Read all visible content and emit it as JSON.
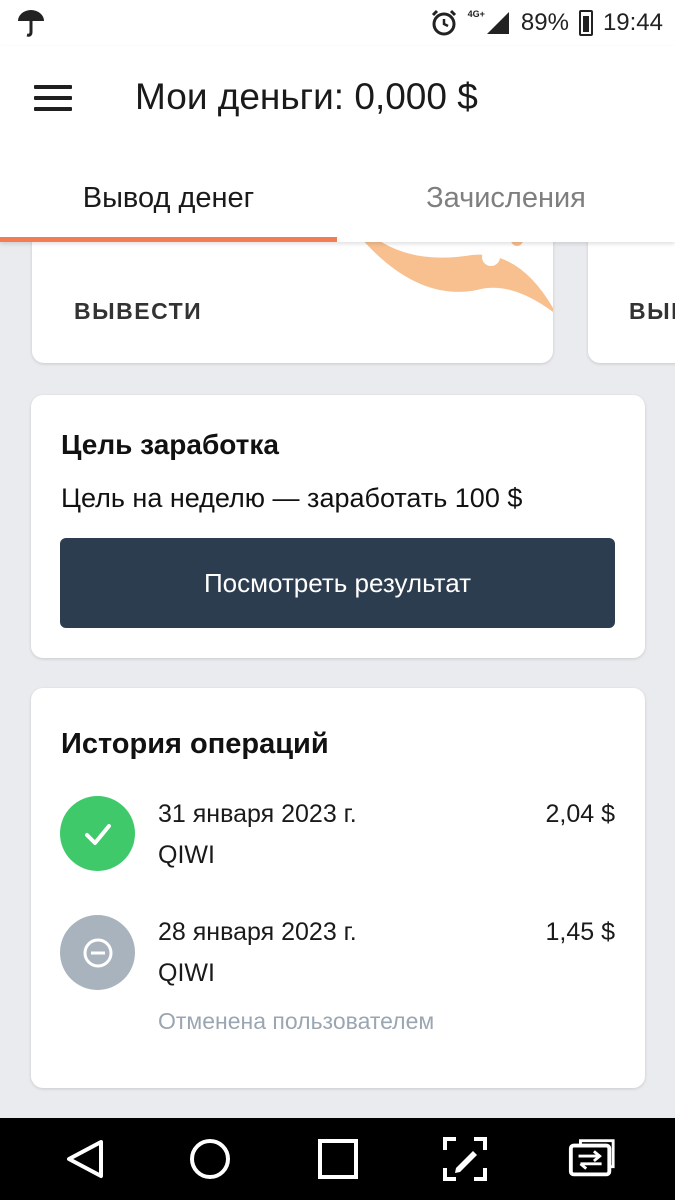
{
  "status_bar": {
    "network": "4G+",
    "battery": "89%",
    "time": "19:44",
    "icons": [
      "umbrella-icon",
      "alarm-icon",
      "signal-icon",
      "battery-icon"
    ]
  },
  "header": {
    "title": "Мои деньги: 0,000 $",
    "menu_icon": "hamburger-menu-icon"
  },
  "tabs": [
    {
      "label": "Вывод денег",
      "active": true
    },
    {
      "label": "Зачисления",
      "active": false
    }
  ],
  "promo_cards": [
    {
      "action_label": "ВЫВЕСТИ"
    },
    {
      "action_label": "ВЫВ"
    }
  ],
  "goal": {
    "title": "Цель заработка",
    "text": "Цель на неделю — заработать 100 $",
    "button_label": "Посмотреть результат"
  },
  "history": {
    "title": "История операций",
    "operations": [
      {
        "date": "31 января 2023 г.",
        "method": "QIWI",
        "amount": "2,04 $",
        "status": "",
        "icon": "check-icon"
      },
      {
        "date": "28 января 2023 г.",
        "method": "QIWI",
        "amount": "1,45 $",
        "status": "Отменена пользователем",
        "icon": "cancel-minus-icon"
      }
    ]
  },
  "colors": {
    "accent": "#f37c53",
    "button_bg": "#2d3d50",
    "success": "#3fc96a",
    "cancelled": "#a9b3bd",
    "background": "#e9ebee"
  },
  "nav_bar": [
    "back-icon",
    "home-icon",
    "recents-icon",
    "screenshot-edit-icon",
    "switch-app-icon"
  ]
}
